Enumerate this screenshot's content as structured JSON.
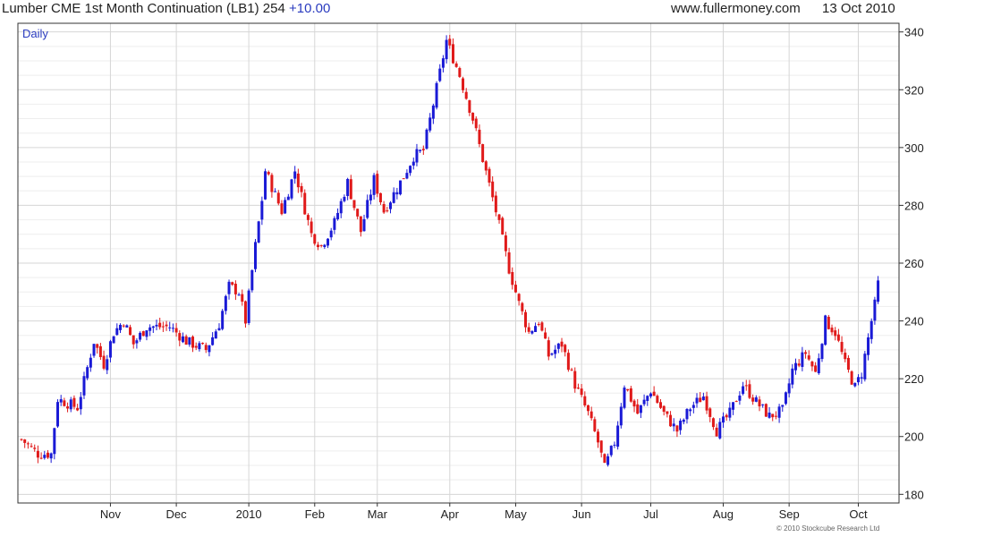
{
  "header": {
    "title": "Lumber CME 1st Month Continuation (LB1) 254",
    "change": "+10.00",
    "site": "www.fullermoney.com",
    "date": "13 Oct 2010"
  },
  "footer": {
    "copyright": "© 2010 Stockcube Research Ltd"
  },
  "colors": {
    "up": "#1a1ad6",
    "down": "#e01a1a",
    "grid": "#d6d6d6",
    "axis": "#333333"
  },
  "chart_data": {
    "type": "candlestick",
    "period_label": "Daily",
    "ylim": [
      177,
      343
    ],
    "y_ticks": [
      180,
      200,
      220,
      240,
      260,
      280,
      300,
      320,
      340
    ],
    "x_tick_labels": [
      "Nov",
      "Dec",
      "2010",
      "Feb",
      "Mar",
      "Apr",
      "May",
      "Jun",
      "Jul",
      "Aug",
      "Sep",
      "Oct"
    ],
    "x_tick_days": [
      27,
      47,
      69,
      89,
      108,
      130,
      150,
      170,
      191,
      213,
      233,
      254
    ],
    "day_range": [
      0,
      265
    ],
    "keypoints": [
      {
        "day": 0,
        "price": 199
      },
      {
        "day": 5,
        "price": 194
      },
      {
        "day": 9,
        "price": 194
      },
      {
        "day": 11,
        "price": 213
      },
      {
        "day": 17,
        "price": 210
      },
      {
        "day": 22,
        "price": 233
      },
      {
        "day": 25,
        "price": 225
      },
      {
        "day": 28,
        "price": 236
      },
      {
        "day": 31,
        "price": 240
      },
      {
        "day": 34,
        "price": 232
      },
      {
        "day": 38,
        "price": 238
      },
      {
        "day": 45,
        "price": 238
      },
      {
        "day": 50,
        "price": 233
      },
      {
        "day": 56,
        "price": 230
      },
      {
        "day": 60,
        "price": 239
      },
      {
        "day": 63,
        "price": 252
      },
      {
        "day": 66,
        "price": 250
      },
      {
        "day": 68,
        "price": 240
      },
      {
        "day": 71,
        "price": 266
      },
      {
        "day": 73,
        "price": 282
      },
      {
        "day": 74,
        "price": 292
      },
      {
        "day": 79,
        "price": 278
      },
      {
        "day": 83,
        "price": 292
      },
      {
        "day": 88,
        "price": 270
      },
      {
        "day": 91,
        "price": 266
      },
      {
        "day": 95,
        "price": 274
      },
      {
        "day": 99,
        "price": 288
      },
      {
        "day": 103,
        "price": 271
      },
      {
        "day": 107,
        "price": 289
      },
      {
        "day": 110,
        "price": 278
      },
      {
        "day": 113,
        "price": 284
      },
      {
        "day": 116,
        "price": 290
      },
      {
        "day": 119,
        "price": 297
      },
      {
        "day": 122,
        "price": 299
      },
      {
        "day": 125,
        "price": 315
      },
      {
        "day": 129,
        "price": 337
      },
      {
        "day": 133,
        "price": 325
      },
      {
        "day": 137,
        "price": 310
      },
      {
        "day": 140,
        "price": 296
      },
      {
        "day": 144,
        "price": 278
      },
      {
        "day": 148,
        "price": 258
      },
      {
        "day": 151,
        "price": 246
      },
      {
        "day": 154,
        "price": 236
      },
      {
        "day": 157,
        "price": 240
      },
      {
        "day": 160,
        "price": 228
      },
      {
        "day": 164,
        "price": 232
      },
      {
        "day": 168,
        "price": 218
      },
      {
        "day": 172,
        "price": 208
      },
      {
        "day": 175,
        "price": 198
      },
      {
        "day": 177,
        "price": 189
      },
      {
        "day": 180,
        "price": 198
      },
      {
        "day": 183,
        "price": 218
      },
      {
        "day": 187,
        "price": 208
      },
      {
        "day": 191,
        "price": 216
      },
      {
        "day": 195,
        "price": 208
      },
      {
        "day": 199,
        "price": 202
      },
      {
        "day": 203,
        "price": 210
      },
      {
        "day": 207,
        "price": 214
      },
      {
        "day": 211,
        "price": 202
      },
      {
        "day": 215,
        "price": 208
      },
      {
        "day": 219,
        "price": 218
      },
      {
        "day": 223,
        "price": 212
      },
      {
        "day": 227,
        "price": 207
      },
      {
        "day": 231,
        "price": 209
      },
      {
        "day": 234,
        "price": 223
      },
      {
        "day": 238,
        "price": 229
      },
      {
        "day": 241,
        "price": 222
      },
      {
        "day": 244,
        "price": 240
      },
      {
        "day": 247,
        "price": 236
      },
      {
        "day": 250,
        "price": 225
      },
      {
        "day": 253,
        "price": 217
      },
      {
        "day": 255,
        "price": 222
      },
      {
        "day": 258,
        "price": 240
      },
      {
        "day": 260,
        "price": 251
      }
    ]
  }
}
